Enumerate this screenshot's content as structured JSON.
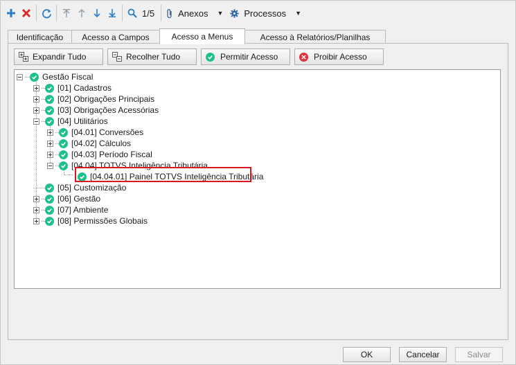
{
  "toolbar": {
    "page_indicator": "1/5",
    "attachments_label": "Anexos",
    "processes_label": "Processos"
  },
  "tabs": [
    {
      "label": "Identificação"
    },
    {
      "label": "Acesso a Campos"
    },
    {
      "label": "Acesso a Menus"
    },
    {
      "label": "Acesso à Relatórios/Planilhas"
    }
  ],
  "actions": {
    "expand_all": "Expandir Tudo",
    "collapse_all": "Recolher Tudo",
    "allow_access": "Permitir Acesso",
    "deny_access": "Proibir Acesso"
  },
  "tree": {
    "root": "Gestão Fiscal",
    "items": [
      "[01] Cadastros",
      "[02] Obrigações Principais",
      "[03] Obrigações Acessórias",
      "[04] Utilitários",
      "[04.01] Conversões",
      "[04.02] Cálculos",
      "[04.03] Período Fiscal",
      "[04.04] TOTVS Inteligência Tributária",
      "[04.04.01] Painel TOTVS Inteligência Tributária",
      "[05] Customização",
      "[06] Gestão",
      "[07] Ambiente",
      "[08] Permissões Globais"
    ]
  },
  "footer": {
    "ok": "OK",
    "cancel": "Cancelar",
    "save": "Salvar"
  },
  "colors": {
    "check_green": "#1fbf8f",
    "deny_red": "#e0323c",
    "highlight_red": "#e0141e",
    "toolbar_blue": "#2a7fc9"
  }
}
